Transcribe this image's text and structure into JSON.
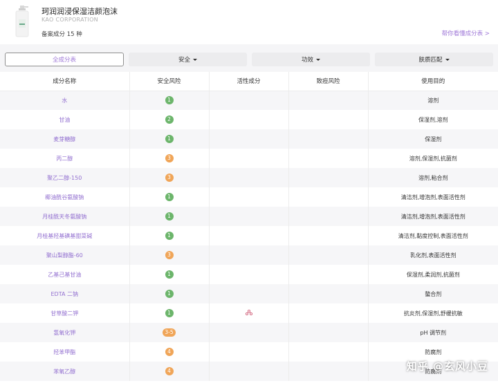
{
  "product": {
    "name": "珂润润浸保湿洁颜泡沫",
    "brand": "KAO CORPORATION",
    "filed_count": "备案成分 15 种",
    "help_link": "帮你看懂成分表 >"
  },
  "filters": {
    "all": "全成分表",
    "safety": "安全",
    "function": "功效",
    "skin": "肤质匹配"
  },
  "table": {
    "headers": [
      "成分名称",
      "安全风险",
      "活性成分",
      "致痘风险",
      "使用目的"
    ],
    "rows": [
      {
        "name": "水",
        "risk": "1",
        "level": "green",
        "active": false,
        "acne": "",
        "purpose": "溶剂"
      },
      {
        "name": "甘油",
        "risk": "2",
        "level": "green",
        "active": false,
        "acne": "",
        "purpose": "保湿剂,溶剂"
      },
      {
        "name": "麦芽糖醇",
        "risk": "1",
        "level": "green",
        "active": false,
        "acne": "",
        "purpose": "保湿剂"
      },
      {
        "name": "丙二醇",
        "risk": "3",
        "level": "orange",
        "active": false,
        "acne": "",
        "purpose": "溶剂,保湿剂,抗菌剂"
      },
      {
        "name": "聚乙二醇-150",
        "risk": "3",
        "level": "orange",
        "active": false,
        "acne": "",
        "purpose": "溶剂,粘合剂"
      },
      {
        "name": "椰油酰谷氨酸钠",
        "risk": "1",
        "level": "green",
        "active": false,
        "acne": "",
        "purpose": "清洁剂,增泡剂,表面活性剂"
      },
      {
        "name": "月桂酰天冬氨酸钠",
        "risk": "1",
        "level": "green",
        "active": false,
        "acne": "",
        "purpose": "清洁剂,增泡剂,表面活性剂"
      },
      {
        "name": "月桂基羟基磺基甜菜碱",
        "risk": "1",
        "level": "green",
        "active": false,
        "acne": "",
        "purpose": "清洁剂,黏度控制,表面活性剂"
      },
      {
        "name": "聚山梨醇酯-60",
        "risk": "3",
        "level": "orange",
        "active": false,
        "acne": "",
        "purpose": "乳化剂,表面活性剂"
      },
      {
        "name": "乙基己基甘油",
        "risk": "1",
        "level": "green",
        "active": false,
        "acne": "",
        "purpose": "保湿剂,柔润剂,抗菌剂"
      },
      {
        "name": "EDTA 二钠",
        "risk": "1",
        "level": "green",
        "active": false,
        "acne": "",
        "purpose": "螯合剂"
      },
      {
        "name": "甘草酸二钾",
        "risk": "1",
        "level": "green",
        "active": true,
        "acne": "",
        "purpose": "抗炎剂,保湿剂,舒缓抗敏"
      },
      {
        "name": "氢氧化钾",
        "risk": "3-5",
        "level": "orange",
        "active": false,
        "acne": "",
        "purpose": "pH 调节剂"
      },
      {
        "name": "羟苯甲酯",
        "risk": "4",
        "level": "orange",
        "active": false,
        "acne": "",
        "purpose": "防腐剂"
      },
      {
        "name": "苯氧乙醇",
        "risk": "4",
        "level": "orange",
        "active": false,
        "acne": "",
        "purpose": "防腐剂"
      }
    ]
  },
  "watermark": "知乎 @玄风小豆",
  "colors": {
    "accent": "#a07ad8",
    "safe": "#6cb56b",
    "warn": "#f0a558",
    "row_alt": "#f6f6f8"
  },
  "icons": {
    "active_ingredient": "molecule-icon"
  }
}
